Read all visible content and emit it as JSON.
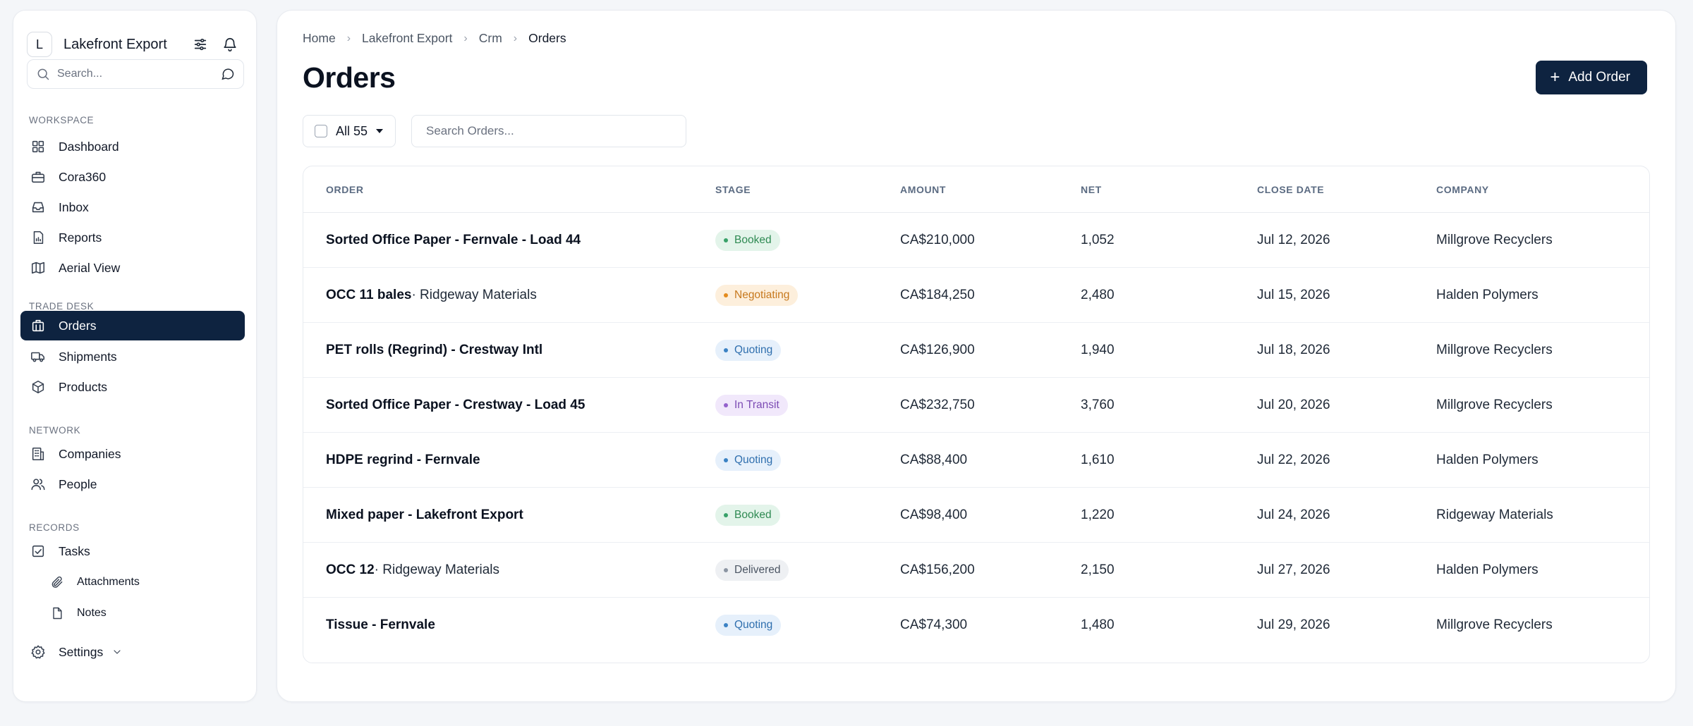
{
  "sidebar": {
    "brand_initial": "L",
    "brand_name": "Lakefront Export",
    "search_placeholder": "Search...",
    "sections": [
      "WORKSPACE",
      "TRADE DESK",
      "NETWORK",
      "RECORDS"
    ],
    "items": [
      {
        "label": "Dashboard",
        "icon": "grid-icon"
      },
      {
        "label": "Cora360",
        "icon": "briefcase-icon"
      },
      {
        "label": "Inbox",
        "icon": "inbox-icon"
      },
      {
        "label": "Reports",
        "icon": "report-icon"
      },
      {
        "label": "Aerial View",
        "icon": "map-icon"
      },
      {
        "label": "Orders",
        "icon": "box-stack-icon",
        "active": true
      },
      {
        "label": "Shipments",
        "icon": "truck-icon"
      },
      {
        "label": "Products",
        "icon": "cube-icon"
      },
      {
        "label": "Companies",
        "icon": "building-icon"
      },
      {
        "label": "People",
        "icon": "people-icon"
      },
      {
        "label": "Tasks",
        "icon": "checkbox-icon"
      },
      {
        "label": "Attachments",
        "icon": "paperclip-icon"
      },
      {
        "label": "Notes",
        "icon": "note-icon"
      },
      {
        "label": "Settings",
        "icon": "gear-icon"
      }
    ]
  },
  "main": {
    "breadcrumb": [
      "Home",
      "Crm",
      "Lakefront Export",
      "Orders"
    ],
    "title": "Orders",
    "add_button": "Add Order",
    "filter_label": "All 55",
    "search_placeholder": "Search Orders...",
    "columns": [
      "ORDER",
      "STAGE",
      "AMOUNT",
      "NET",
      "CLOSE DATE",
      "COMPANY"
    ],
    "rows": [
      {
        "order": "Sorted Office Paper - Fernvale - Load 44",
        "order_rest": "",
        "stage": "Booked",
        "amount": "CA$210,000",
        "net": "1,052",
        "close": "Jul 12, 2026",
        "company": "Millgrove Recyclers"
      },
      {
        "order": "OCC 11 bales",
        "order_rest": " · Ridgeway Materials",
        "stage": "Negotiating",
        "amount": "CA$184,250",
        "net": "2,480",
        "close": "Jul 15, 2026",
        "company": "Halden Polymers"
      },
      {
        "order": "PET rolls (Regrind) - Crestway Intl",
        "order_rest": "",
        "stage": "Quoting",
        "amount": "CA$126,900",
        "net": "1,940",
        "close": "Jul 18, 2026",
        "company": "Millgrove Recyclers"
      },
      {
        "order": "Sorted Office Paper - Crestway - Load 45",
        "order_rest": "",
        "stage": "In Transit",
        "amount": "CA$232,750",
        "net": "3,760",
        "close": "Jul 20, 2026",
        "company": "Millgrove Recyclers"
      },
      {
        "order": "HDPE regrind - Fernvale",
        "order_rest": "",
        "stage": "Quoting",
        "amount": "CA$88,400",
        "net": "1,610",
        "close": "Jul 22, 2026",
        "company": "Halden Polymers"
      },
      {
        "order": "Mixed paper - Lakefront Export",
        "order_rest": "",
        "stage": "Booked",
        "amount": "CA$98,400",
        "net": "1,220",
        "close": "Jul 24, 2026",
        "company": "Ridgeway Materials"
      },
      {
        "order": "OCC 12",
        "order_rest": " · Ridgeway Materials",
        "stage": "Delivered",
        "amount": "CA$156,200",
        "net": "2,150",
        "close": "Jul 27, 2026",
        "company": "Halden Polymers"
      },
      {
        "order": "Tissue - Fernvale",
        "order_rest": "",
        "stage": "Quoting",
        "amount": "CA$74,300",
        "net": "1,480",
        "close": "Jul 29, 2026",
        "company": "Millgrove Recyclers"
      }
    ]
  },
  "colors": {
    "accent": "#0e2340",
    "stage_booked": {
      "bg": "#e3f4ea",
      "fg": "#2f8a53",
      "dot": "#38a169"
    },
    "stage_negotiating": {
      "bg": "#fdefdc",
      "fg": "#c7791e",
      "dot": "#e38b1e"
    },
    "stage_quoting": {
      "bg": "#e6f0fb",
      "fg": "#2f6fae",
      "dot": "#3b82c4"
    },
    "stage_in_transit": {
      "bg": "#f1e8fb",
      "fg": "#7c4bb4",
      "dot": "#9461cc"
    },
    "stage_delivered": {
      "bg": "#eef0f3",
      "fg": "#4b5563",
      "dot": "#8b95a3"
    }
  }
}
